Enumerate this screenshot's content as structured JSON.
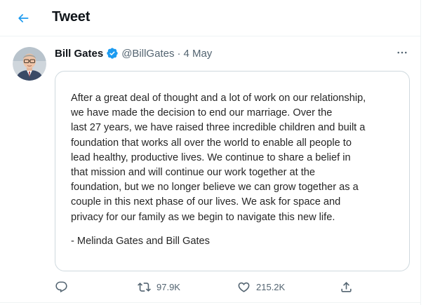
{
  "header": {
    "title": "Tweet",
    "back_icon": "arrow-left-icon"
  },
  "tweet": {
    "author": {
      "name": "Bill Gates",
      "handle": "@BillGates",
      "verified": true
    },
    "date": "4 May",
    "separator": "·",
    "more_icon": "more-horizontal-icon",
    "statement_lines": [
      "After a great deal of thought and a lot of work on our relationship,",
      "we have made the decision to end our marriage. Over the",
      "last 27 years, we have raised three incredible children and built a",
      "foundation that works all over the world to enable all people to",
      "lead healthy, productive lives. We continue to share a belief in",
      "that mission and will continue our work together at the",
      "foundation, but we no longer believe we can grow together as a",
      "couple in this next phase of our lives. We ask for space and",
      "privacy for our family as we begin to navigate this new life."
    ],
    "signature": "- Melinda Gates and Bill Gates",
    "actions": {
      "reply": {
        "icon": "reply-icon"
      },
      "retweet": {
        "icon": "retweet-icon",
        "count": "97.9K"
      },
      "like": {
        "icon": "heart-icon",
        "count": "215.2K"
      },
      "share": {
        "icon": "share-icon"
      }
    }
  },
  "colors": {
    "accent": "#1d9bf0",
    "text": "#0f1419",
    "secondary": "#536471",
    "border": "#cfd9de"
  }
}
